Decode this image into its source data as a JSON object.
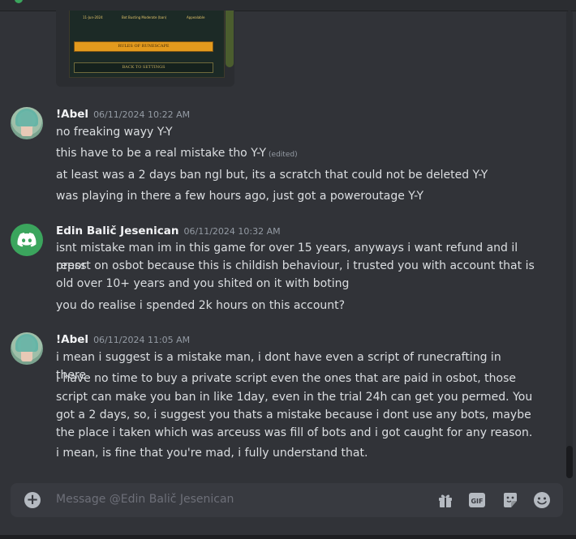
{
  "embed": {
    "row_date": "11-Jun-2024",
    "row_reason": "Bot Busting Moderate (ban)",
    "row_status": "Appealable",
    "rules_button": "RULES OF RUNESCAPE",
    "back_button": "BACK TO SETTINGS"
  },
  "messages": [
    {
      "author": "!Abel",
      "timestamp": "06/11/2024 10:22 AM",
      "lines": [
        "no freaking wayy Y-Y",
        "this have to be a real mistake tho Y-Y",
        "at least was a 2 days ban ngl but, its a scratch that could not be deleted Y-Y",
        "was playing in there a few hours ago, just got a poweroutage Y-Y"
      ],
      "edited_label": "(edited)"
    },
    {
      "author": "Edin Balič Jesenican",
      "timestamp": "06/11/2024 10:32 AM",
      "lines": [
        "isnt mistake man im in this game for over 15 years, anyways i want refund and il press",
        "report on osbot because this is childish behaviour, i trusted you with account that is",
        "old over 10+ years and you shited on it with boting",
        "you do realise i spended 2k hours on this account?"
      ]
    },
    {
      "author": "!Abel",
      "timestamp": "06/11/2024 11:05 AM",
      "lines": [
        "i mean i suggest is a mistake man, i dont have even a script of runecrafting in there",
        "i have no time to buy a private script even the ones that are paid in osbot, those",
        "script can make you ban in like 1day, even in the trial 24h can get you permed. You",
        "got a 2 days, so, i suggest you thats a mistake because i dont use any bots, maybe",
        "the place i taken which was arceuss was fill of bots and i got caught for any reason.",
        "i mean, is fine that you're mad, i fully understand that."
      ]
    }
  ],
  "composer": {
    "placeholder": "Message @Edin Balič Jesenican",
    "icons": [
      "add-icon",
      "gift-icon",
      "gif-icon",
      "sticker-icon",
      "emoji-icon"
    ]
  },
  "colors": {
    "background": "#313338",
    "discord_green": "#3ba55d",
    "text": "#dbdee1",
    "timestamp": "#949ba4"
  }
}
